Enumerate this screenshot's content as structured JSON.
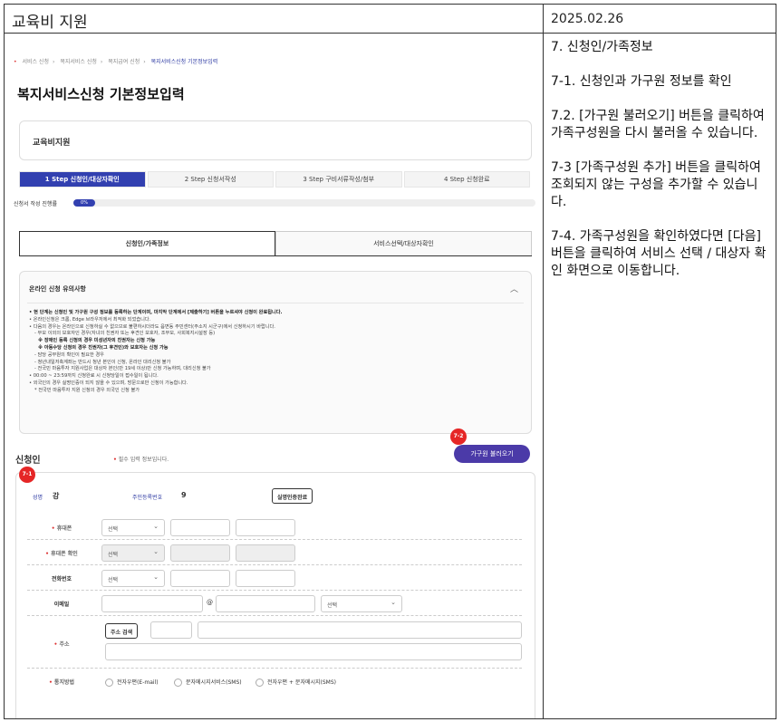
{
  "header": {
    "title": "교육비 지원",
    "date": "2025.02.26"
  },
  "guide": [
    "7. 신청인/가족정보",
    "7-1. 신청인과 가구원 정보를 확인",
    "7.2. [가구원 불러오기] 버튼을 클릭하여 가족구성원을 다시 불러올 수 있습니다.",
    "7-3 [가족구성원 추가] 버튼을 클릭하여 조회되지 않는 구성을 추가할 수 있습니다.",
    "7-4. 가족구성원을 확인하였다면 [다음] 버튼을 클릭하여 서비스 선택 / 대상자 확인 화면으로 이동합니다."
  ],
  "breadcrumb": [
    "서비스 신청",
    "복지서비스 신청",
    "복지급여 신청",
    "복지서비스신청 기본정보입력"
  ],
  "page_title": "복지서비스신청 기본정보입력",
  "service_name": "교육비지원",
  "steps": [
    "1 Step 신청인/대상자확인",
    "2 Step 신청서작성",
    "3 Step 구비서류작성/첨부",
    "4 Step 신청완료"
  ],
  "progress": {
    "label": "신청서 작성 진행률",
    "value": "0%"
  },
  "tabs": [
    "신청인/가족정보",
    "서비스선택/대상자확인"
  ],
  "notice": {
    "title": "온라인 신청 유의사항",
    "items": [
      "• 현 단계는 신청인 및 가구원 구성 정보를 등록하는 단계이며, 마지막 단계에서 [제출하기] 버튼을 누르셔야 신청이 완료됩니다.",
      "• 온라인신청은 크롬, Edge 브라우저에서 최적화 되었습니다.",
      "• 다음의 경우는 온라인으로 신청하실 수 없으므로 불편하시더라도 읍면동 주민센터(주소지 시군구)에서 신청하시기 바랍니다.",
      "- 부모 이외의 보호자인 경우(자녀의 친권자 또는 후견인 보호자, 조부모, 사회복지시설장 등)",
      "※ 장애인 등록 신청의 경우 미성년자의 친권자는 신청 가능",
      "※ 아동수당 신청의 경우 친권자(그 후견인)와 보호자는 신청 가능",
      "- 담당 공무원의 확인이 필요한 경우",
      "- 청년내일저축계좌는 반드시 청년 본인이 신청, 온라인 대리신청 불가",
      "- 전국민 마음투자 지원사업은 대상자 본인(만 19세 이상)만 신청 가능하며, 대리신청 불가",
      "• 00:00 ~ 23:59까지 신청완료 시 신청당일이 접수일이 됩니다.",
      "• 외국인의 경우 실명인증이 되지 않을 수 있으며, 방문으로만 신청이 가능합니다.",
      "* 전국민 마음투자 지원 신청의 경우 외국인 신청 불가"
    ]
  },
  "applicant": {
    "section_title": "신청인",
    "required_note": "필수 입력 정보입니다.",
    "load_family_button": "가구원 불러오기",
    "name_label": "성명",
    "name_value": "강",
    "rrn_label": "주민등록번호",
    "rrn_value": "9",
    "verified_button": "실명인증완료",
    "mobile_label": "휴대폰",
    "mobile_confirm_label": "휴대폰 확인",
    "phone_label": "전화번호",
    "email_label": "이메일",
    "email_at": "@",
    "select_placeholder": "선택",
    "address_label": "주소",
    "address_search_button": "주소 검색",
    "notify_label": "통지방법",
    "notify_options": [
      "전자우편(E-mail)",
      "문자메시지서비스(SMS)",
      "전자우편 + 문자메시지(SMS)"
    ]
  },
  "badges": [
    "7-1",
    "7-2"
  ]
}
